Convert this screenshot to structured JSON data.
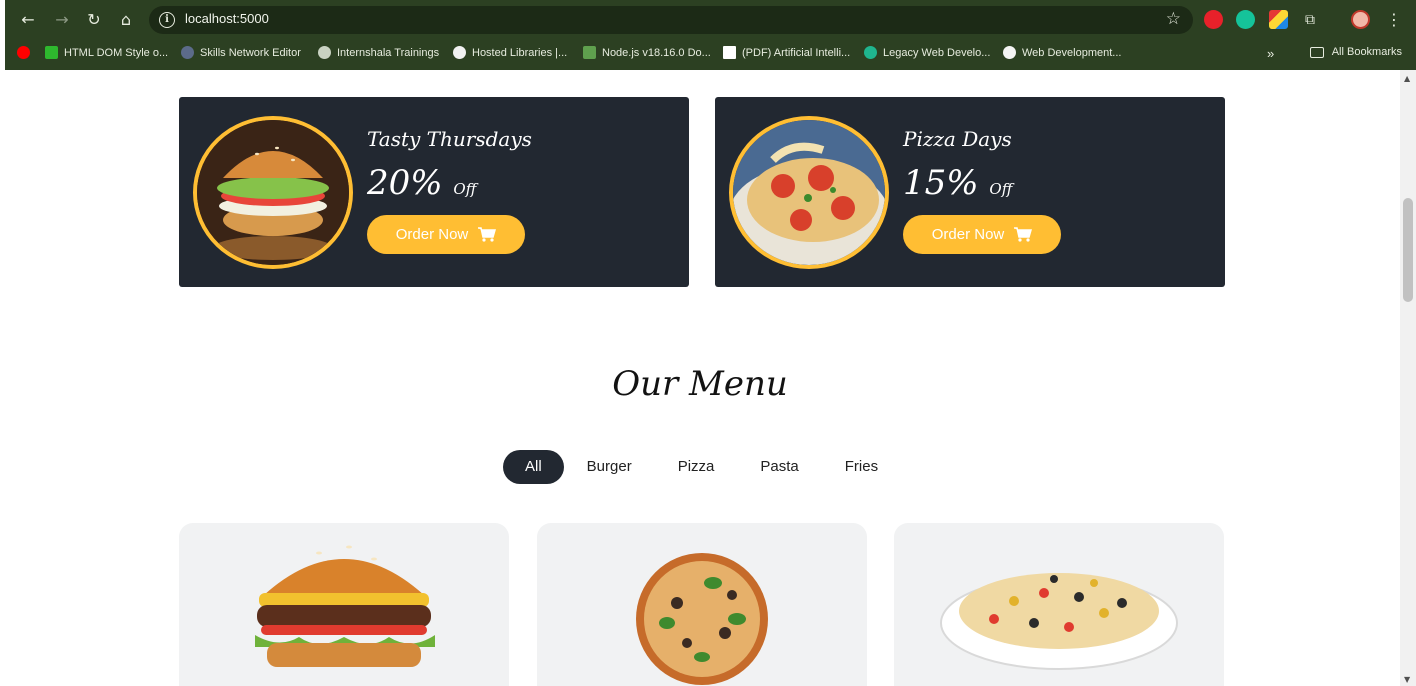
{
  "browser": {
    "url": "localhost:5000",
    "bookmarks": [
      "HTML DOM Style o...",
      "Skills Network Editor",
      "Internshala Trainings",
      "Hosted Libraries |...",
      "Node.js v18.16.0 Do...",
      "(PDF) Artificial Intelli...",
      "Legacy Web Develo...",
      "Web Development..."
    ],
    "bookmarks_overflow": "»",
    "all_bookmarks": "All Bookmarks"
  },
  "offers": [
    {
      "title": "Tasty Thursdays",
      "percent": "20%",
      "off": "Off",
      "button": "Order Now",
      "image": "burger"
    },
    {
      "title": "Pizza Days",
      "percent": "15%",
      "off": "Off",
      "button": "Order Now",
      "image": "pizza"
    }
  ],
  "menu": {
    "title": "Our Menu",
    "filters": [
      "All",
      "Burger",
      "Pizza",
      "Pasta",
      "Fries"
    ],
    "active_filter": "All",
    "items": [
      "burger",
      "pizza",
      "pasta"
    ]
  },
  "colors": {
    "accent": "#ffbe33",
    "dark": "#222831",
    "chrome": "#2c4022"
  }
}
